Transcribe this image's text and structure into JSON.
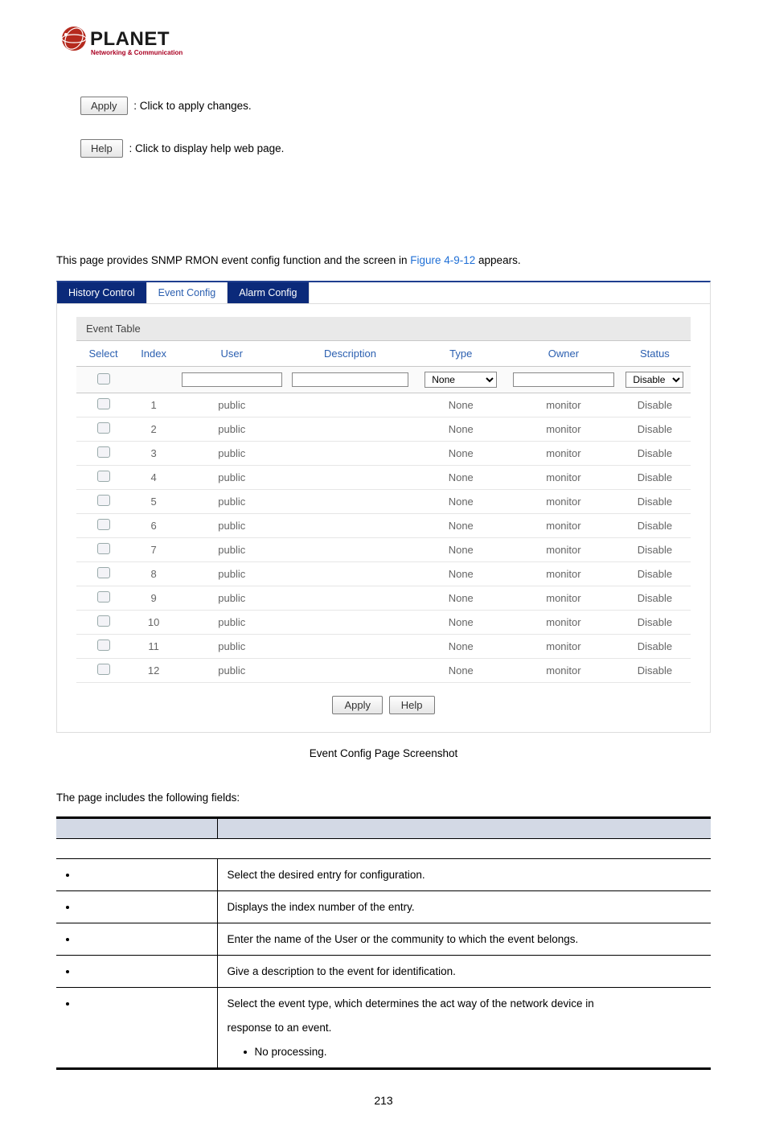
{
  "logo": {
    "brand_top": "PLANET",
    "brand_sub": "Networking & Communication"
  },
  "top_buttons": {
    "apply_label": "Apply",
    "apply_desc": ": Click to apply changes.",
    "help_label": "Help",
    "help_desc": ": Click to display help web page."
  },
  "intro": {
    "before_link": "This page provides SNMP RMON event config function and the screen in ",
    "link_text": "Figure 4-9-12",
    "after_link": " appears."
  },
  "tabs": {
    "history": "History Control",
    "event": "Event Config",
    "alarm": "Alarm Config"
  },
  "card_title": "Event Table",
  "columns": {
    "select": "Select",
    "index": "Index",
    "user": "User",
    "description": "Description",
    "type": "Type",
    "owner": "Owner",
    "status": "Status"
  },
  "filter_row": {
    "type_selected": "None",
    "status_selected": "Disable"
  },
  "rows": [
    {
      "index": "1",
      "user": "public",
      "description": "",
      "type": "None",
      "owner": "monitor",
      "status": "Disable"
    },
    {
      "index": "2",
      "user": "public",
      "description": "",
      "type": "None",
      "owner": "monitor",
      "status": "Disable"
    },
    {
      "index": "3",
      "user": "public",
      "description": "",
      "type": "None",
      "owner": "monitor",
      "status": "Disable"
    },
    {
      "index": "4",
      "user": "public",
      "description": "",
      "type": "None",
      "owner": "monitor",
      "status": "Disable"
    },
    {
      "index": "5",
      "user": "public",
      "description": "",
      "type": "None",
      "owner": "monitor",
      "status": "Disable"
    },
    {
      "index": "6",
      "user": "public",
      "description": "",
      "type": "None",
      "owner": "monitor",
      "status": "Disable"
    },
    {
      "index": "7",
      "user": "public",
      "description": "",
      "type": "None",
      "owner": "monitor",
      "status": "Disable"
    },
    {
      "index": "8",
      "user": "public",
      "description": "",
      "type": "None",
      "owner": "monitor",
      "status": "Disable"
    },
    {
      "index": "9",
      "user": "public",
      "description": "",
      "type": "None",
      "owner": "monitor",
      "status": "Disable"
    },
    {
      "index": "10",
      "user": "public",
      "description": "",
      "type": "None",
      "owner": "monitor",
      "status": "Disable"
    },
    {
      "index": "11",
      "user": "public",
      "description": "",
      "type": "None",
      "owner": "monitor",
      "status": "Disable"
    },
    {
      "index": "12",
      "user": "public",
      "description": "",
      "type": "None",
      "owner": "monitor",
      "status": "Disable"
    }
  ],
  "buttons": {
    "apply": "Apply",
    "help": "Help"
  },
  "caption": "Event Config Page Screenshot",
  "fields_intro": "The page includes the following fields:",
  "fields": [
    {
      "desc": "Select the desired entry for configuration."
    },
    {
      "desc": "Displays the index number of the entry."
    },
    {
      "desc": "Enter the name of the User or the community to which the event belongs."
    },
    {
      "desc": "Give a description to the event for identification."
    }
  ],
  "last_field": {
    "line1": "Select the event type, which determines the act way of the network device in",
    "line2": "response to an event.",
    "sub": "No processing."
  },
  "page_number": "213"
}
